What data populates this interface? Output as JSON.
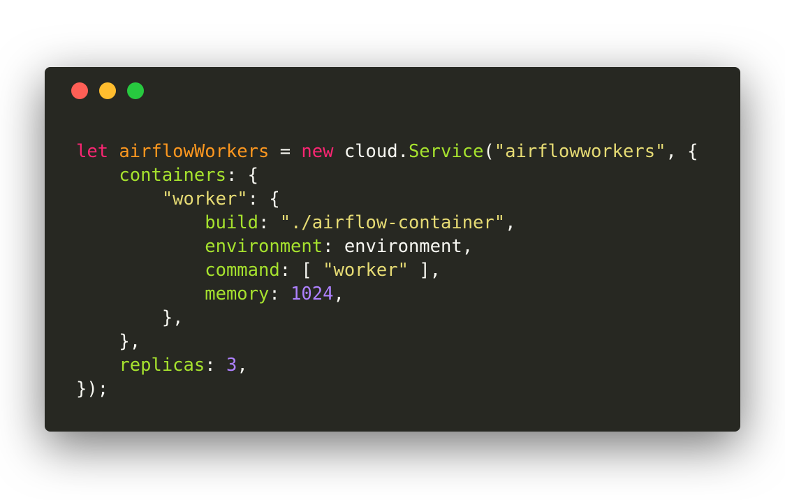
{
  "window": {
    "controls": {
      "close_color": "#ff5f56",
      "minimize_color": "#ffbd2e",
      "maximize_color": "#27c93f"
    },
    "theme": {
      "background": "#272822",
      "keyword": "#f92672",
      "variable": "#fd971f",
      "function_property": "#a6e22e",
      "string": "#e6db74",
      "number": "#ae81ff",
      "text": "#f8f8f2"
    }
  },
  "code": {
    "l1": {
      "kw_let": "let",
      "sp1": " ",
      "var_name": "airflowWorkers",
      "eq": " = ",
      "kw_new": "new",
      "obj": " cloud.",
      "cls": "Service",
      "open": "(",
      "arg": "\"airflowworkers\"",
      "rest": ", {"
    },
    "l2": {
      "indent": "    ",
      "key": "containers",
      "rest": ": {"
    },
    "l3": {
      "indent": "        ",
      "key": "\"worker\"",
      "rest": ": {"
    },
    "l4": {
      "indent": "            ",
      "key": "build",
      "sep": ": ",
      "val": "\"./airflow-container\"",
      "rest": ","
    },
    "l5": {
      "indent": "            ",
      "key": "environment",
      "rest": ": environment,"
    },
    "l6": {
      "indent": "            ",
      "key": "command",
      "sep": ": [ ",
      "val": "\"worker\"",
      "rest": " ],"
    },
    "l7": {
      "indent": "            ",
      "key": "memory",
      "sep": ": ",
      "val": "1024",
      "rest": ","
    },
    "l8": {
      "text": "        },"
    },
    "l9": {
      "text": "    },"
    },
    "l10": {
      "indent": "    ",
      "key": "replicas",
      "sep": ": ",
      "val": "3",
      "rest": ","
    },
    "l11": {
      "text": "});"
    }
  }
}
